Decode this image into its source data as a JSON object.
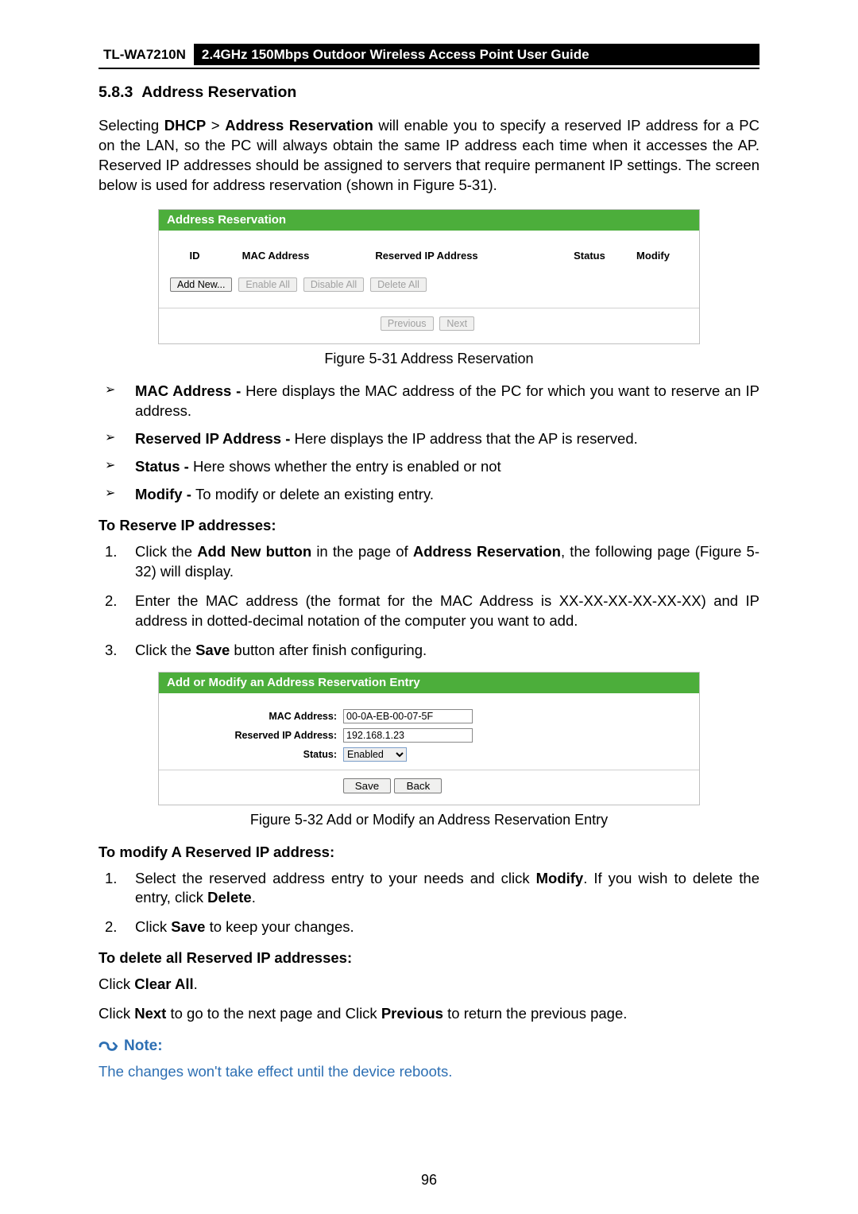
{
  "header": {
    "model": "TL-WA7210N",
    "title": "2.4GHz 150Mbps Outdoor Wireless Access Point User Guide"
  },
  "section": {
    "number": "5.8.3",
    "title": "Address Reservation"
  },
  "intro": {
    "pre": "Selecting ",
    "b1": "DHCP",
    "sep": " > ",
    "b2": "Address Reservation",
    "rest": " will enable you to specify a reserved IP address for a PC on the LAN, so the PC will always obtain the same IP address each time when it accesses the AP. Reserved IP addresses should be assigned to servers that require permanent IP settings. The screen below is used for address reservation (shown in Figure 5-31)."
  },
  "fig1": {
    "panel_title": "Address Reservation",
    "cols": {
      "id": "ID",
      "mac": "MAC Address",
      "ip": "Reserved IP Address",
      "status": "Status",
      "modify": "Modify"
    },
    "buttons": {
      "addnew": "Add New...",
      "enable": "Enable All",
      "disable": "Disable All",
      "delete": "Delete All"
    },
    "pag": {
      "prev": "Previous",
      "next": "Next"
    },
    "caption": "Figure 5-31 Address Reservation"
  },
  "bullets": {
    "b1_b": "MAC Address - ",
    "b1_t": "Here displays the MAC address of the PC for which you want to reserve an IP address.",
    "b2_b": "Reserved IP Address - ",
    "b2_t": "Here displays the IP address that the AP is reserved.",
    "b3_b": "Status - ",
    "b3_t": "Here shows whether the entry is enabled or not",
    "b4_b": "Modify - ",
    "b4_t": "To modify or delete an existing entry."
  },
  "reserve": {
    "heading": "To Reserve IP addresses:",
    "s1_a": "Click the ",
    "s1_b": "Add New button",
    "s1_c": " in the page of ",
    "s1_d": "Address Reservation",
    "s1_e": ", the following page (Figure 5-32) will display.",
    "s2": "Enter the MAC address (the format for the MAC Address is XX-XX-XX-XX-XX-XX) and IP address in dotted-decimal notation of the computer you want to add.",
    "s3_a": "Click the ",
    "s3_b": "Save",
    "s3_c": " button after finish configuring."
  },
  "fig2": {
    "panel_title": "Add or Modify an Address Reservation Entry",
    "labels": {
      "mac": "MAC Address:",
      "ip": "Reserved IP Address:",
      "status": "Status:"
    },
    "values": {
      "mac": "00-0A-EB-00-07-5F",
      "ip": "192.168.1.23",
      "status": "Enabled"
    },
    "buttons": {
      "save": "Save",
      "back": "Back"
    },
    "caption": "Figure 5-32 Add or Modify an Address Reservation Entry"
  },
  "modify": {
    "heading": "To modify A Reserved IP address:",
    "s1_a": "Select the reserved address entry to your needs and click ",
    "s1_b": "Modify",
    "s1_c": ". If you wish to delete the entry, click ",
    "s1_d": "Delete",
    "s1_e": ".",
    "s2_a": "Click ",
    "s2_b": "Save",
    "s2_c": " to keep your changes."
  },
  "deleteall": {
    "heading": "To delete all Reserved IP addresses:",
    "line1_a": "Click ",
    "line1_b": "Clear All",
    "line1_c": ".",
    "line2_a": "Click ",
    "line2_b": "Next",
    "line2_c": " to go to the next page and Click ",
    "line2_d": "Previous",
    "line2_e": " to return the previous page."
  },
  "note": {
    "label": "Note:",
    "body": "The changes won't take effect until the device reboots."
  },
  "page_number": "96"
}
